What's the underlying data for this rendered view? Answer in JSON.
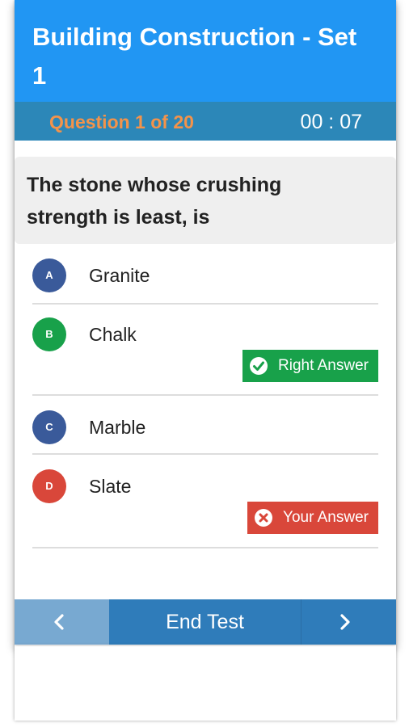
{
  "header": {
    "title": "Building Construction - Set 1"
  },
  "status": {
    "question_counter": "Question 1 of 20",
    "timer": "00 : 07",
    "counter_color": "#f4934a"
  },
  "question": {
    "text": "The stone whose crushing strength is least, is"
  },
  "options": [
    {
      "letter": "A",
      "label": "Granite",
      "color": "#3a5a9a"
    },
    {
      "letter": "B",
      "label": "Chalk",
      "color": "#18a14a"
    },
    {
      "letter": "C",
      "label": "Marble",
      "color": "#3a5a9a"
    },
    {
      "letter": "D",
      "label": "Slate",
      "color": "#d9473a"
    }
  ],
  "feedback": {
    "right_answer_label": "Right Answer",
    "right_answer_color": "#18a14a",
    "right_answer_icon": "check-circle-icon",
    "your_answer_label": "Your Answer",
    "your_answer_color": "#d9473a",
    "your_answer_icon": "x-circle-icon"
  },
  "navigation": {
    "prev_icon": "chevron-left-icon",
    "end_label": "End Test",
    "next_icon": "chevron-right-icon"
  },
  "colors": {
    "header": "#2196f3",
    "subbar": "#2c87b8",
    "nav": "#2f7cba"
  }
}
